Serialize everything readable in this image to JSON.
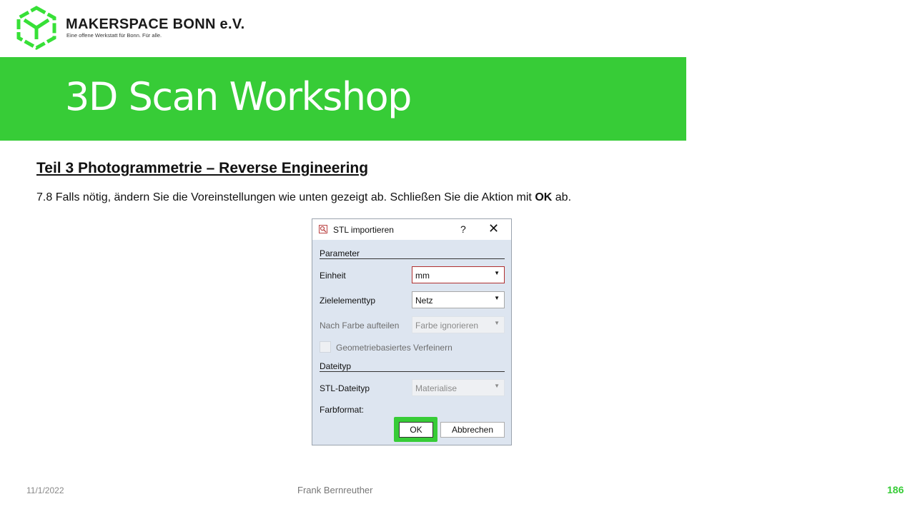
{
  "header": {
    "org_name": "MAKERSPACE BONN e.V.",
    "tagline": "Eine offene Werkstatt für Bonn. Für alle.",
    "logo_icon": "hexagon-cube-logo-icon",
    "brand_color": "#37cc37"
  },
  "banner": {
    "title": "3D Scan Workshop"
  },
  "content": {
    "heading": "Teil 3  Photogrammetrie  – Reverse Engineering",
    "instruction_pre": "7.8 Falls nötig, ändern Sie die Voreinstellungen wie unten gezeigt ab. Schließen Sie die Aktion mit ",
    "instruction_bold": "OK",
    "instruction_post": " ab."
  },
  "dialog": {
    "title": "STL importieren",
    "help_label": "?",
    "close_label": "✕",
    "group_parameter": "Parameter",
    "einheit_label": "Einheit",
    "einheit_value": "mm",
    "zielelementtyp_label": "Zielelementtyp",
    "zielelementtyp_value": "Netz",
    "farbe_label": "Nach Farbe aufteilen",
    "farbe_value": "Farbe ignorieren",
    "checkbox_label": "Geometriebasiertes Verfeinern",
    "group_dateityp": "Dateityp",
    "stl_dateityp_label": "STL-Dateityp",
    "stl_dateityp_value": "Materialise",
    "farbformat_label": "Farbformat:",
    "ok_label": "OK",
    "cancel_label": "Abbrechen"
  },
  "footer": {
    "date": "11/1/2022",
    "author": "Frank Bernreuther",
    "page_number": "186"
  }
}
